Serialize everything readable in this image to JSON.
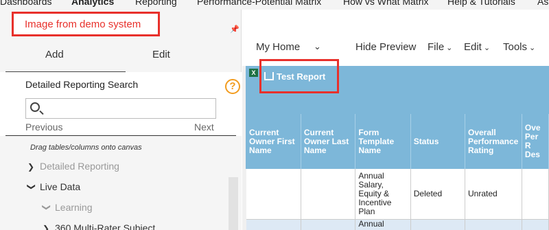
{
  "topnav": {
    "items": [
      "Dashboards",
      "Analytics",
      "Reporting",
      "Performance-Potential Matrix",
      "How vs What Matrix",
      "Help & Tutorials",
      "As"
    ]
  },
  "annotation": {
    "text": "Image from demo system"
  },
  "left_panel": {
    "tabs": {
      "add": "Add",
      "edit": "Edit"
    },
    "search": {
      "title": "Detailed Reporting Search",
      "placeholder": "",
      "previous": "Previous",
      "next": "Next"
    },
    "hint": "Drag tables/columns onto canvas",
    "tree": [
      {
        "label": "Detailed Reporting",
        "state": "collapsed",
        "dimmed": true
      },
      {
        "label": "Live Data",
        "state": "expanded",
        "dimmed": false
      },
      {
        "label": "Learning",
        "state": "expanded",
        "dimmed": true
      },
      {
        "label": "360 Multi-Rater Subject",
        "state": "collapsed",
        "dimmed": false
      }
    ]
  },
  "toolbar": {
    "home": "My Home",
    "hide_preview": "Hide Preview",
    "file": "File",
    "edit": "Edit",
    "tools": "Tools"
  },
  "preview": {
    "report_button": "Test Report",
    "columns": [
      "Current Owner First Name",
      "Current Owner Last Name",
      "Form Template Name",
      "Status",
      "Overall Performance Rating",
      "Ove Per R Des"
    ],
    "rows": [
      [
        "",
        "",
        "Annual Salary, Equity & Incentive Plan",
        "Deleted",
        "Unrated",
        ""
      ],
      [
        "",
        "",
        "Annual",
        "",
        "",
        ""
      ]
    ]
  },
  "colors": {
    "header_blue": "#7db7d9",
    "annotation_red": "#e8302b",
    "help_orange": "#f29c1f"
  }
}
